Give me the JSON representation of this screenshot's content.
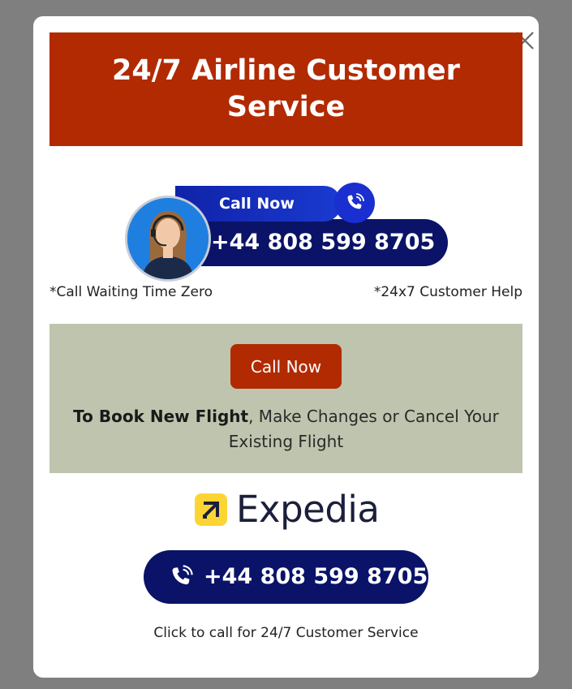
{
  "banner": {
    "title": "24/7 Airline Customer Service"
  },
  "agent_widget": {
    "call_now_label": "Call Now",
    "phone_number": "+44 808 599 8705"
  },
  "notes": {
    "left": "*Call Waiting Time Zero",
    "right": "*24x7 Customer Help"
  },
  "book_panel": {
    "button_label": "Call Now",
    "text_bold": "To Book New Flight",
    "text_rest": ", Make Changes or Cancel Your Existing Flight"
  },
  "brand": {
    "name": "Expedia"
  },
  "call_button": {
    "phone_number": "+44 808 599 8705"
  },
  "footer": {
    "text": "Click to call for 24/7 Customer Service"
  },
  "colors": {
    "overlay": "#7f7f7f",
    "accent_red": "#b22a02",
    "navy": "#0a1368",
    "panel_bg": "#bfc4ae",
    "expedia_yellow": "#fcd535"
  },
  "icons": [
    "close-icon",
    "phone-icon",
    "agent-avatar",
    "expedia-logo-icon"
  ]
}
